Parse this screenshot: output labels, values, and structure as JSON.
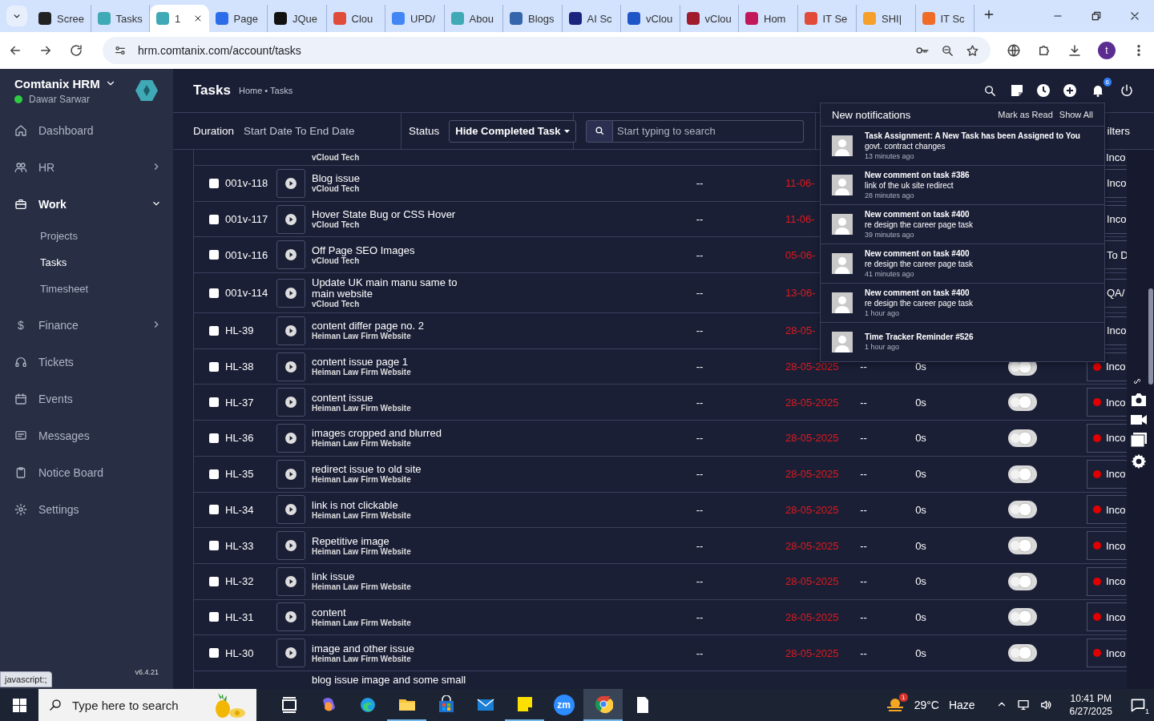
{
  "browser": {
    "tabs": [
      {
        "label": "Scree",
        "color": "#222222",
        "selected": false
      },
      {
        "label": "Tasks",
        "color": "#3fa9b5",
        "selected": false
      },
      {
        "label": "1",
        "color": "#3fa9b5",
        "selected": true
      },
      {
        "label": "Page",
        "color": "#2b6de8",
        "selected": false
      },
      {
        "label": "JQue",
        "color": "#111111",
        "selected": false
      },
      {
        "label": "Clou",
        "color": "#e04b3a",
        "selected": false
      },
      {
        "label": "UPD/",
        "color": "#4285f4",
        "selected": false
      },
      {
        "label": "Abou",
        "color": "#3fa9b5",
        "selected": false
      },
      {
        "label": "Blogs",
        "color": "#3366aa",
        "selected": false
      },
      {
        "label": "AI Sc",
        "color": "#1a237e",
        "selected": false
      },
      {
        "label": "vClou",
        "color": "#1e56c8",
        "selected": false
      },
      {
        "label": "vClou",
        "color": "#a01c2c",
        "selected": false
      },
      {
        "label": "Hom",
        "color": "#c2185b",
        "selected": false
      },
      {
        "label": "IT Se",
        "color": "#e04b3a",
        "selected": false
      },
      {
        "label": "SHI|",
        "color": "#f4a02a",
        "selected": false
      },
      {
        "label": "IT Sc",
        "color": "#f06b26",
        "selected": false
      }
    ],
    "url": "hrm.comtanix.com/account/tasks",
    "profile_initial": "t",
    "status_url": "javascript:;"
  },
  "sidebar": {
    "brand": "Comtanix HRM",
    "user": "Dawar Sarwar",
    "online": true,
    "version": "v6.4.21",
    "items": [
      {
        "label": "Dashboard",
        "selected": false
      },
      {
        "label": "HR",
        "selected": false,
        "expanded": false
      },
      {
        "label": "Work",
        "selected": true,
        "expanded": true,
        "children": [
          {
            "label": "Projects",
            "selected": false
          },
          {
            "label": "Tasks",
            "selected": true
          },
          {
            "label": "Timesheet",
            "selected": false
          }
        ]
      },
      {
        "label": "Finance",
        "glyph": "$",
        "selected": false,
        "expanded": false
      },
      {
        "label": "Tickets",
        "selected": false
      },
      {
        "label": "Events",
        "selected": false
      },
      {
        "label": "Messages",
        "selected": false
      },
      {
        "label": "Notice Board",
        "selected": false
      },
      {
        "label": "Settings",
        "selected": false
      }
    ]
  },
  "header": {
    "title": "Tasks",
    "breadcrumb": "Home • Tasks",
    "notification_count": "6"
  },
  "filters": {
    "duration_label": "Duration",
    "duration_value": "Start Date To End Date",
    "status_label": "Status",
    "status_value": "Hide Completed Task",
    "search_placeholder": "Start typing to search",
    "filters_label": "ilters"
  },
  "table": {
    "rows": [
      {
        "kind": "partial-top",
        "project": "vCloud Tech",
        "status": "Inco"
      },
      {
        "kind": "covered",
        "checked": false,
        "id": "001v-118",
        "title": "Blog issue",
        "project": "vCloud Tech",
        "estimate": "--",
        "due": "11-06-",
        "status": "Inco"
      },
      {
        "kind": "covered",
        "checked": false,
        "id": "001v-117",
        "title": "Hover State Bug or CSS Hover",
        "project": "vCloud Tech",
        "estimate": "--",
        "due": "11-06-",
        "status": "Inco"
      },
      {
        "kind": "covered",
        "checked": false,
        "id": "001v-116",
        "title": "Off Page SEO Images",
        "project": "vCloud Tech",
        "estimate": "--",
        "due": "05-06-",
        "status": "To D"
      },
      {
        "kind": "covered",
        "checked": false,
        "id": "001v-114",
        "title": "Update UK main manu same to main website",
        "project": "vCloud Tech",
        "estimate": "--",
        "due": "13-06-",
        "status": "QA/"
      },
      {
        "kind": "covered",
        "checked": false,
        "id": "HL-39",
        "title": "content differ page no. 2",
        "project": "Heiman Law Firm Website",
        "estimate": "--",
        "due": "28-05-",
        "status": "Inco"
      },
      {
        "kind": "full",
        "checked": false,
        "id": "HL-38",
        "title": "content issue page 1",
        "project": "Heiman Law Firm Website",
        "estimate": "--",
        "due": "28-05-2025",
        "logged": "--",
        "time": "0s",
        "status": "Inco",
        "color": "#e00000"
      },
      {
        "kind": "full",
        "checked": false,
        "id": "HL-37",
        "title": "content issue",
        "project": "Heiman Law Firm Website",
        "estimate": "--",
        "due": "28-05-2025",
        "logged": "--",
        "time": "0s",
        "status": "Inco",
        "color": "#e00000"
      },
      {
        "kind": "full",
        "checked": false,
        "id": "HL-36",
        "title": "images cropped and blurred",
        "project": "Heiman Law Firm Website",
        "estimate": "--",
        "due": "28-05-2025",
        "logged": "--",
        "time": "0s",
        "status": "Inco",
        "color": "#e00000"
      },
      {
        "kind": "full",
        "checked": false,
        "id": "HL-35",
        "title": "redirect issue to old site",
        "project": "Heiman Law Firm Website",
        "estimate": "--",
        "due": "28-05-2025",
        "logged": "--",
        "time": "0s",
        "status": "Inco",
        "color": "#e00000"
      },
      {
        "kind": "full",
        "checked": false,
        "id": "HL-34",
        "title": "link is not clickable",
        "project": "Heiman Law Firm Website",
        "estimate": "--",
        "due": "28-05-2025",
        "logged": "--",
        "time": "0s",
        "status": "Inco",
        "color": "#e00000"
      },
      {
        "kind": "full",
        "checked": false,
        "id": "HL-33",
        "title": "Repetitive image",
        "project": "Heiman Law Firm Website",
        "estimate": "--",
        "due": "28-05-2025",
        "logged": "--",
        "time": "0s",
        "status": "Inco",
        "color": "#e00000"
      },
      {
        "kind": "full",
        "checked": false,
        "id": "HL-32",
        "title": "link issue",
        "project": "Heiman Law Firm Website",
        "estimate": "--",
        "due": "28-05-2025",
        "logged": "--",
        "time": "0s",
        "status": "Inco",
        "color": "#e00000"
      },
      {
        "kind": "full",
        "checked": false,
        "id": "HL-31",
        "title": "content",
        "project": "Heiman Law Firm Website",
        "estimate": "--",
        "due": "28-05-2025",
        "logged": "--",
        "time": "0s",
        "status": "Inco",
        "color": "#e00000"
      },
      {
        "kind": "full",
        "checked": false,
        "id": "HL-30",
        "title": "image and other issue",
        "project": "Heiman Law Firm Website",
        "estimate": "--",
        "due": "28-05-2025",
        "logged": "--",
        "time": "0s",
        "status": "Inco",
        "color": "#e00000"
      },
      {
        "kind": "partial-bottom",
        "title": "blog issue image and some small"
      }
    ]
  },
  "notifications": {
    "title": "New notifications",
    "mark_read": "Mark as Read",
    "show_all": "Show All",
    "items": [
      {
        "title": "Task Assignment: A New Task has been Assigned to You",
        "detail": "govt. contract changes",
        "time": "13 minutes ago"
      },
      {
        "title": "New comment on task #386",
        "detail": "link of the uk site redirect",
        "time": "28 minutes ago"
      },
      {
        "title": "New comment on task #400",
        "detail": "re design the career page task",
        "time": "39 minutes ago"
      },
      {
        "title": "New comment on task #400",
        "detail": "re design the career page task",
        "time": "41 minutes ago"
      },
      {
        "title": "New comment on task #400",
        "detail": "re design the career page task",
        "time": "1 hour ago"
      },
      {
        "title": "Time Tracker Reminder #526",
        "time": "1 hour ago"
      }
    ]
  },
  "taskbar": {
    "search_placeholder": "Type here to search",
    "apps": [
      {
        "running": false,
        "active": false
      },
      {
        "running": false,
        "active": false
      },
      {
        "running": false,
        "active": false
      },
      {
        "running": true,
        "active": false
      },
      {
        "running": false,
        "active": false
      },
      {
        "running": false,
        "active": false
      },
      {
        "running": true,
        "active": false
      },
      {
        "running": false,
        "active": false,
        "label": "zm"
      },
      {
        "running": true,
        "active": true
      },
      {
        "running": false,
        "active": false
      }
    ],
    "weather_badge": "1",
    "temperature": "29°C",
    "weather": "Haze",
    "time": "10:41 PM",
    "date": "6/27/2025",
    "notification_count": "1"
  }
}
